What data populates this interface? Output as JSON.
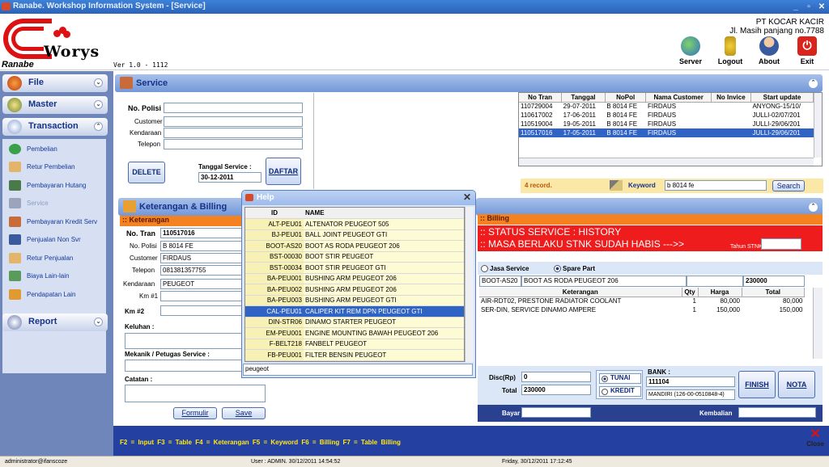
{
  "window": {
    "title": "Ranabe. Workshop Information System - [Service]"
  },
  "header": {
    "version": "Ver 1.0 - 1112",
    "company": "PT KOCAR KACIR",
    "address": "Jl. Masih panjang no.7788",
    "logo_text": "Worys",
    "logo_brand": "Ranabe",
    "toolbar": [
      {
        "label": "Server",
        "icon": "globe-computer-icon"
      },
      {
        "label": "Logout",
        "icon": "keys-icon"
      },
      {
        "label": "About",
        "icon": "person-icon"
      },
      {
        "label": "Exit",
        "icon": "power-icon"
      }
    ]
  },
  "sidebar": {
    "sections": [
      {
        "label": "File"
      },
      {
        "label": "Master"
      },
      {
        "label": "Transaction"
      },
      {
        "label": "Report"
      }
    ],
    "items": [
      {
        "label": "Pembelian"
      },
      {
        "label": "Retur Pembelian"
      },
      {
        "label": "Pembayaran Hutang"
      },
      {
        "label": "Service"
      },
      {
        "label": "Pembayaran Kredit Serv"
      },
      {
        "label": "Penjualan Non Svr"
      },
      {
        "label": "Retur Penjualan"
      },
      {
        "label": "Biaya Lain-lain"
      },
      {
        "label": "Pendapatan Lain"
      }
    ]
  },
  "service": {
    "title": "Service",
    "no_polisi_label": "No. Polisi",
    "no_polisi": "",
    "customer_label": "Customer",
    "kendaraan_label": "Kendaraan",
    "telepon_label": "Telepon",
    "delete": "DELETE",
    "tanggal_label": "Tanggal Service :",
    "tanggal": "30-12-2011",
    "daftar": "DAFTAR",
    "table": {
      "headers": [
        "No Tran",
        "Tanggal",
        "NoPol",
        "Nama Customer",
        "No Invice",
        "Start update"
      ],
      "rows": [
        [
          "110729004",
          "29-07-2011",
          "B 8014 FE",
          "FIRDAUS",
          "",
          "ANYONG-15/10/"
        ],
        [
          "110617002",
          "17-06-2011",
          "B 8014 FE",
          "FIRDAUS",
          "",
          "JULLI-02/07/201"
        ],
        [
          "110519004",
          "19-05-2011",
          "B 8014 FE",
          "FIRDAUS",
          "",
          "JULLI-29/06/201"
        ],
        [
          "110517016",
          "17-05-2011",
          "B 8014 FE",
          "FIRDAUS",
          "",
          "JULLI-29/06/201"
        ]
      ]
    },
    "record_count": "4 record.",
    "keyword_label": "Keyword",
    "keyword": "b 8014 fe",
    "search": "Search"
  },
  "keterangan": {
    "title": "Keterangan & Billing",
    "section": ":: Keterangan",
    "no_tran_label": "No. Tran",
    "no_tran": "110517016",
    "no_polisi_label": "No. Polisi",
    "no_polisi": "B 8014 FE",
    "customer_label": "Customer",
    "customer": "FIRDAUS",
    "telepon_label": "Telepon",
    "telepon": "081381357755",
    "kendaraan_label": "Kendaraan",
    "kendaraan": "PEUGEOT",
    "km1_label": "Km #1",
    "km2_label": "Km #2",
    "keluhan_label": "Keluhan :",
    "mekanik_label": "Mekanik / Petugas Service :",
    "catatan_label": "Catatan :",
    "formulir": "Formulir",
    "save": "Save"
  },
  "help": {
    "title": "Help",
    "headers": [
      "ID",
      "NAME"
    ],
    "search": "peugeot",
    "rows": [
      [
        "ALT-PEU01",
        "ALTENATOR PEUGEOT 505"
      ],
      [
        "BJ-PEU01",
        "BALL JOINT PEUGEOT GTI"
      ],
      [
        "BOOT-AS20",
        "BOOT AS RODA PEUGEOT 206"
      ],
      [
        "BST-00030",
        "BOOT STIR PEUGEOT"
      ],
      [
        "BST-00034",
        "BOOT STIR PEUGEOT GTI"
      ],
      [
        "BA-PEU001",
        "BUSHING ARM PEUGEOT 206"
      ],
      [
        "BA-PEU002",
        "BUSHING ARM PEUGEOT 206"
      ],
      [
        "BA-PEU003",
        "BUSHING ARM PEUGEOT GTI"
      ],
      [
        "CAL-PEU01",
        "CALIPER KIT REM DPN PEUGEOT GTI"
      ],
      [
        "DIN-STR06",
        "DINAMO STARTER PEUGEOT"
      ],
      [
        "EM-PEU001",
        "ENGINE MOUNTING BAWAH PEUGEOT 206"
      ],
      [
        "F-BELT218",
        "FANBELT PEUGEOT"
      ],
      [
        "FB-PEU001",
        "FILTER BENSIN PEUGEOT"
      ]
    ]
  },
  "billing": {
    "section": ":: Billing",
    "status1": ":: STATUS SERVICE : HISTORY",
    "status2": ":: MASA BERLAKU STNK SUDAH HABIS --->>",
    "tahun_stnk_label": "Tahun STNK",
    "jasa": "Jasa Service",
    "spare": "Spare Part",
    "input_code": "BOOT-AS20",
    "input_name": "BOOT AS RODA PEUGEOT 206",
    "input_price": "230000",
    "headers": [
      "Keterangan",
      "Qty",
      "Harga",
      "Total"
    ],
    "rows": [
      [
        "AIR-RDT02, PRESTONE RADIATOR COOLANT",
        "1",
        "80,000",
        "80,000"
      ],
      [
        "SER-DIN, SERVICE DINAMO AMPERE",
        "1",
        "150,000",
        "150,000"
      ]
    ],
    "disc_label": "Disc(Rp)",
    "disc": "0",
    "total_label": "Total",
    "total": "230000",
    "tunai": "TUNAI",
    "kredit": "KREDIT",
    "bank_label": "BANK :",
    "bank_code": "111104",
    "bank_name": "MANDIRI (126-00-0510848-4)",
    "finish": "FINISH",
    "nota": "NOTA",
    "bayar_label": "Bayar",
    "kembalian_label": "Kembalian"
  },
  "footer": {
    "keys": "F2 = Input    F3 = Table    F4 = Keterangan    F5 = Keyword    F6 = Billing    F7 = Table Billing",
    "close": "Close"
  },
  "status": {
    "user_email": "administrator@ifanscoze",
    "user": "User : ADMIN. 30/12/2011  14:54:52",
    "date": "Friday, 30/12/2011   17:12:45"
  }
}
